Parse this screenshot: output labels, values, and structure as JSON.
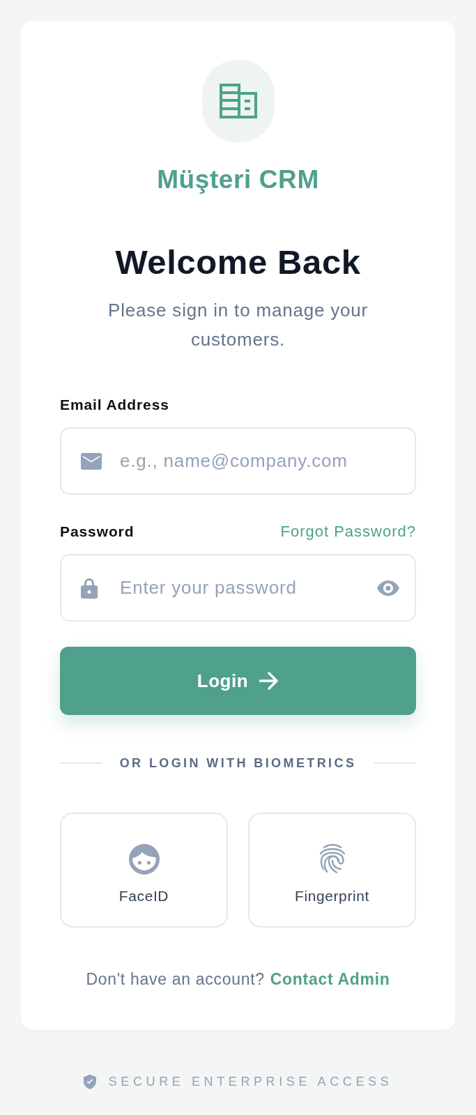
{
  "brand": {
    "name": "Müşteri CRM"
  },
  "heading": {
    "title": "Welcome Back",
    "subtitle": "Please sign in to manage your customers."
  },
  "form": {
    "fields": [
      {
        "kind": "email",
        "label": "Email Address",
        "placeholder": "e.g., name@company.com"
      },
      {
        "kind": "password",
        "label": "Password",
        "link": "Forgot Password?",
        "placeholder": "Enter your password"
      }
    ],
    "submit": {
      "label": "Login"
    }
  },
  "biometrics": {
    "divider": "OR LOGIN WITH BIOMETRICS",
    "options": [
      {
        "kind": "face",
        "label": "FaceID"
      },
      {
        "kind": "fingerprint",
        "label": "Fingerprint"
      }
    ]
  },
  "signup": {
    "prompt": "Don't have an account?",
    "link": "Contact Admin"
  },
  "footer": {
    "text": "SECURE ENTERPRISE ACCESS"
  }
}
